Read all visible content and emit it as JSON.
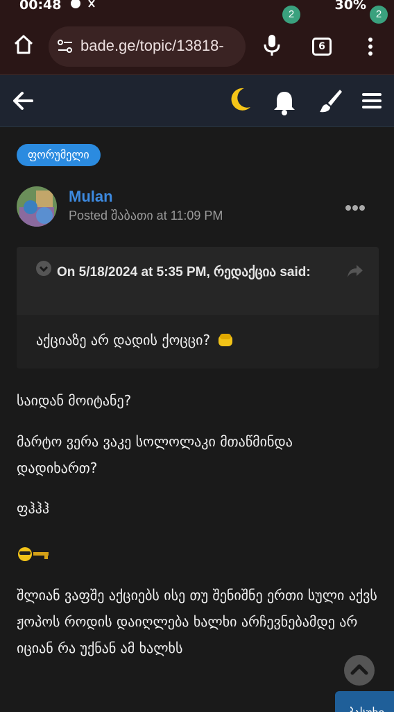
{
  "status_bar": {
    "time": "00:48",
    "battery": "30%"
  },
  "browser": {
    "url": "bade.ge/topic/13818-",
    "tab_count": "6"
  },
  "header": {
    "notifications_count": "2",
    "menu_count": "2"
  },
  "post": {
    "tag": "ფორუმელი",
    "author": "Mulan",
    "meta": "Posted შაბათი at 11:09 PM",
    "quote": {
      "cite": "On 5/18/2024 at 5:35 PM, რედაქცია said:",
      "body": "აქციაზე არ დადის ქოცცი?"
    },
    "paragraphs": [
      "საიდან მოიტანე?",
      "მარტო ვერა ვაკე სოლოლაკი მთაწმინდა დადიხართ?",
      "ფჰჰჰ",
      "შლიან ვაფშე აქციებს ისე თუ შენიშნე ერთი სული აქვს ჟოპოს როდის დაიღლება ხალხი არჩევნებამდე არ იციან რა უქნან ამ ხალხს"
    ],
    "reply_label": "პასუხი"
  },
  "colors": {
    "accent": "#2b8be0",
    "author": "#3d8ae0",
    "badge": "#3aa17e",
    "moon": "#f5c518"
  }
}
